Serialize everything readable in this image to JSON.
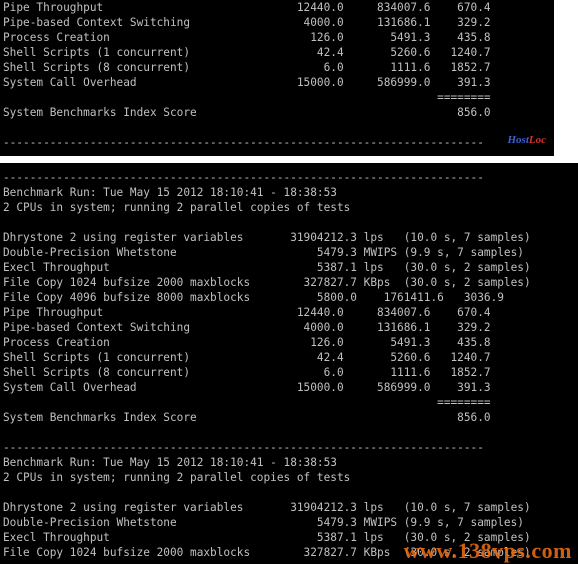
{
  "top_panel": {
    "lines": [
      "Pipe Throughput                             12440.0     834007.6    670.4",
      "Pipe-based Context Switching                 4000.0     131686.1    329.2",
      "Process Creation                              126.0       5491.3    435.8",
      "Shell Scripts (1 concurrent)                   42.4       5260.6   1240.7",
      "Shell Scripts (8 concurrent)                    6.0       1111.6   1852.7",
      "System Call Overhead                        15000.0     586999.0    391.3",
      "                                                                 ========",
      "System Benchmarks Index Score                                       856.0",
      "",
      "------------------------------------------------------------------------"
    ],
    "watermark_main": "Host",
    "watermark_accent": "Loc"
  },
  "bottom_panel": {
    "lines": [
      "------------------------------------------------------------------------",
      "Benchmark Run: Tue May 15 2012 18:10:41 - 18:38:53",
      "2 CPUs in system; running 2 parallel copies of tests",
      "",
      "Dhrystone 2 using register variables       31904212.3 lps   (10.0 s, 7 samples)",
      "Double-Precision Whetstone                     5479.3 MWIPS (9.9 s, 7 samples)",
      "Execl Throughput                               5387.1 lps   (30.0 s, 2 samples)",
      "File Copy 1024 bufsize 2000 maxblocks        327827.7 KBps  (30.0 s, 2 samples)",
      "File Copy 4096 bufsize 8000 maxblocks          5800.0    1761411.6   3036.9",
      "Pipe Throughput                             12440.0     834007.6    670.4",
      "Pipe-based Context Switching                 4000.0     131686.1    329.2",
      "Process Creation                              126.0       5491.3    435.8",
      "Shell Scripts (1 concurrent)                   42.4       5260.6   1240.7",
      "Shell Scripts (8 concurrent)                    6.0       1111.6   1852.7",
      "System Call Overhead                        15000.0     586999.0    391.3",
      "                                                                 ========",
      "System Benchmarks Index Score                                       856.0",
      "",
      "------------------------------------------------------------------------",
      "Benchmark Run: Tue May 15 2012 18:10:41 - 18:38:53",
      "2 CPUs in system; running 2 parallel copies of tests",
      "",
      "Dhrystone 2 using register variables       31904212.3 lps   (10.0 s, 7 samples)",
      "Double-Precision Whetstone                     5479.3 MWIPS (9.9 s, 7 samples)",
      "Execl Throughput                               5387.1 lps   (30.0 s, 2 samples)",
      "File Copy 1024 bufsize 2000 maxblocks        327827.7 KBps  (30.0 s, 2 samples)"
    ],
    "watermark": "www.138vps.com"
  }
}
